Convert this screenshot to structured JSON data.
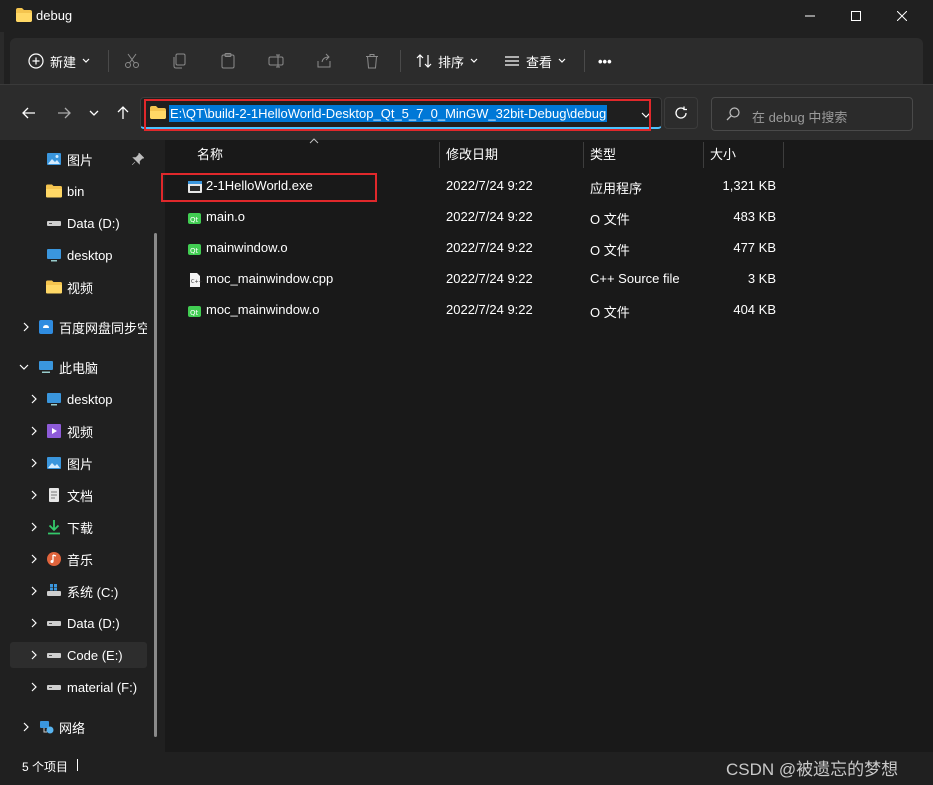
{
  "window": {
    "title": "debug"
  },
  "title_controls": [
    "minimize",
    "maximize",
    "close"
  ],
  "toolbar": {
    "new_label": "新建",
    "sort_label": "排序",
    "view_label": "查看",
    "more_label": "•••"
  },
  "address": {
    "path": "E:\\QT\\build-2-1HelloWorld-Desktop_Qt_5_7_0_MinGW_32bit-Debug\\debug"
  },
  "search": {
    "placeholder": "在 debug 中搜索"
  },
  "sidebar": {
    "items": [
      {
        "label": "图片",
        "icon": "pictures-icon",
        "pinned": true
      },
      {
        "label": "bin",
        "icon": "folder-icon"
      },
      {
        "label": "Data (D:)",
        "icon": "drive-icon"
      },
      {
        "label": "desktop",
        "icon": "desktop-icon"
      },
      {
        "label": "视频",
        "icon": "folder-icon"
      },
      {
        "label": "百度网盘同步空间",
        "icon": "cloud-sync-icon"
      },
      {
        "label": "此电脑",
        "icon": "computer-icon"
      },
      {
        "label": "desktop",
        "icon": "desktop-icon"
      },
      {
        "label": "视频",
        "icon": "videos-icon"
      },
      {
        "label": "图片",
        "icon": "pictures-icon"
      },
      {
        "label": "文档",
        "icon": "documents-icon"
      },
      {
        "label": "下载",
        "icon": "downloads-icon"
      },
      {
        "label": "音乐",
        "icon": "music-icon"
      },
      {
        "label": "系统 (C:)",
        "icon": "windows-drive-icon"
      },
      {
        "label": "Data (D:)",
        "icon": "drive-icon"
      },
      {
        "label": "Code (E:)",
        "icon": "drive-icon",
        "selected": true
      },
      {
        "label": "material (F:)",
        "icon": "drive-icon"
      },
      {
        "label": "网络",
        "icon": "network-icon"
      }
    ]
  },
  "columns": {
    "name": "名称",
    "modified": "修改日期",
    "type": "类型",
    "size": "大小"
  },
  "files": [
    {
      "name": "2-1HelloWorld.exe",
      "modified": "2022/7/24 9:22",
      "type": "应用程序",
      "size": "1,321 KB",
      "icon": "exe-icon"
    },
    {
      "name": "main.o",
      "modified": "2022/7/24 9:22",
      "type": "O 文件",
      "size": "483 KB",
      "icon": "qt-object-icon"
    },
    {
      "name": "mainwindow.o",
      "modified": "2022/7/24 9:22",
      "type": "O 文件",
      "size": "477 KB",
      "icon": "qt-object-icon"
    },
    {
      "name": "moc_mainwindow.cpp",
      "modified": "2022/7/24 9:22",
      "type": "C++ Source file",
      "size": "3 KB",
      "icon": "cpp-file-icon"
    },
    {
      "name": "moc_mainwindow.o",
      "modified": "2022/7/24 9:22",
      "type": "O 文件",
      "size": "404 KB",
      "icon": "qt-object-icon"
    }
  ],
  "status": {
    "item_count": "5 个项目"
  },
  "watermark": "CSDN @被遗忘的梦想",
  "colors": {
    "accent": "#4cc2ff",
    "highlight": "#0078d7",
    "annotation": "#e0282b",
    "background": "#202020"
  }
}
